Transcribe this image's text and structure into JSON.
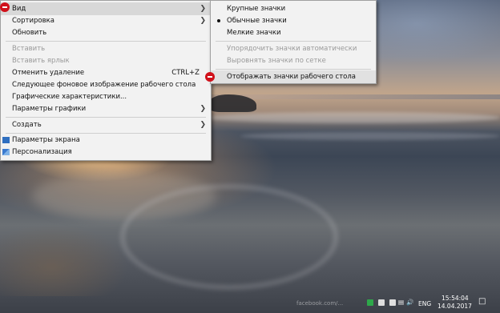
{
  "context_menu": {
    "items": [
      {
        "label": "Вид",
        "submenu": true
      },
      {
        "label": "Сортировка",
        "submenu": true
      },
      {
        "label": "Обновить"
      },
      {
        "label": "Вставить",
        "disabled": true
      },
      {
        "label": "Вставить ярлык",
        "disabled": true
      },
      {
        "label": "Отменить удаление",
        "shortcut": "CTRL+Z"
      },
      {
        "label": "Следующее фоновое изображение рабочего стола"
      },
      {
        "label": "Графические характеристики..."
      },
      {
        "label": "Параметры графики",
        "submenu": true
      },
      {
        "label": "Создать",
        "submenu": true
      },
      {
        "label": "Параметры экрана",
        "icon": "display-icon"
      },
      {
        "label": "Персонализация",
        "icon": "personalize-icon"
      }
    ]
  },
  "view_submenu": {
    "items": [
      {
        "label": "Крупные значки"
      },
      {
        "label": "Обычные значки",
        "selected": true
      },
      {
        "label": "Мелкие значки"
      },
      {
        "label": "Упорядочить значки автоматически",
        "disabled": true
      },
      {
        "label": "Выровнять значки по сетке",
        "disabled": true
      },
      {
        "label": "Отображать значки рабочего стола",
        "highlighted": true
      }
    ]
  },
  "taskbar": {
    "language": "ENG",
    "time": "15:54:04",
    "date": "14.04.2017",
    "watermark": "facebook.com/..."
  },
  "colors": {
    "marker": "#d0101a",
    "menu_bg": "#f2f2f2"
  }
}
